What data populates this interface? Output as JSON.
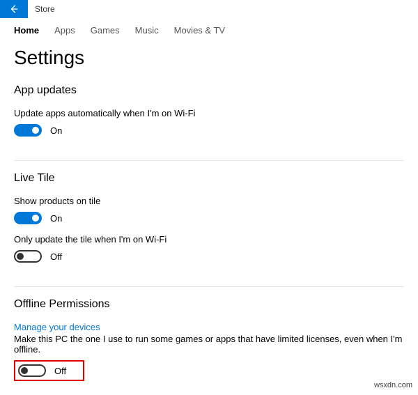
{
  "window": {
    "title": "Store"
  },
  "tabs": {
    "items": [
      {
        "label": "Home",
        "selected": true
      },
      {
        "label": "Apps",
        "selected": false
      },
      {
        "label": "Games",
        "selected": false
      },
      {
        "label": "Music",
        "selected": false
      },
      {
        "label": "Movies & TV",
        "selected": false
      }
    ]
  },
  "page": {
    "title": "Settings"
  },
  "sections": {
    "app_updates": {
      "title": "App updates",
      "auto_update": {
        "label": "Update apps automatically when I'm on Wi-Fi",
        "state": "On",
        "on": true
      }
    },
    "live_tile": {
      "title": "Live Tile",
      "show_products": {
        "label": "Show products on tile",
        "state": "On",
        "on": true
      },
      "wifi_only": {
        "label": "Only update the tile when I'm on Wi-Fi",
        "state": "Off",
        "on": false
      }
    },
    "offline": {
      "title": "Offline Permissions",
      "manage_link": "Manage your devices",
      "description": "Make this PC the one I use to run some games or apps that have limited licenses, even when I'm offline.",
      "toggle": {
        "state": "Off",
        "on": false
      }
    }
  },
  "watermark": "wsxdn.com",
  "colors": {
    "accent": "#0078d7",
    "highlight": "#e00000"
  }
}
